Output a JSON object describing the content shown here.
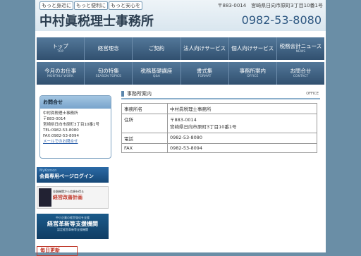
{
  "header": {
    "tagline": [
      "もっと身近に",
      "もっと便利に",
      "もっと安心を"
    ],
    "address": "〒883-0014　宮崎県日向市原町3丁目10番1号",
    "company": "中村眞税理士事務所",
    "phone": "0982-53-8080"
  },
  "nav_row1": [
    {
      "main": "トップ",
      "sub": "TOP"
    },
    {
      "main": "経営理念",
      "sub": ""
    },
    {
      "main": "ご契約",
      "sub": ""
    },
    {
      "main": "法人向けサービス",
      "sub": ""
    },
    {
      "main": "個人向けサービス",
      "sub": ""
    },
    {
      "main": "税務会計ニュース",
      "sub": "NEWS"
    }
  ],
  "nav_row2": [
    {
      "main": "今月のお仕事",
      "sub": "MONTHLY WORK"
    },
    {
      "main": "旬の特集",
      "sub": "SEASON TOPICS"
    },
    {
      "main": "税務基礎講座",
      "sub": "Q&A"
    },
    {
      "main": "書式集",
      "sub": "FORMAT"
    },
    {
      "main": "事務所案内",
      "sub": "OFFICE"
    },
    {
      "main": "お問合せ",
      "sub": "CONTACT"
    }
  ],
  "sidebar": {
    "contact_title": "お問合せ",
    "contact_lines": [
      "中村眞税理士事務所",
      "〒883-0014",
      "宮崎県日向市原町3丁目10番1号",
      "TEL:0982-53-8080",
      "FAX:0982-53-8094"
    ],
    "contact_link": "メールでのお問合せ",
    "login_top": "MyKomon",
    "login_main": "会員専用ページログイン",
    "plan_small": "金融機関から信頼を得る",
    "plan_main": "経営改善計画",
    "kakushin_small": "中小企業の経営強化を支援",
    "kakushin_main": "経営革新等支援機関",
    "kakushin_sub": "認定経営革新等支援機関",
    "red_banner": "毎日更新"
  },
  "main": {
    "section_title": "事務所案内",
    "section_en": "OFFICE",
    "rows": [
      {
        "label": "事務所名",
        "value": "中村眞税理士事務所"
      },
      {
        "label": "住所",
        "value": "〒883-0014\n宮崎県日向市原町3丁目10番1号"
      },
      {
        "label": "電話",
        "value": "0982-53-8080"
      },
      {
        "label": "FAX",
        "value": "0982-53-8094"
      }
    ]
  },
  "colors": {
    "background": "#6a8ea6",
    "nav": "#37597a",
    "accent": "#5c87ad"
  }
}
